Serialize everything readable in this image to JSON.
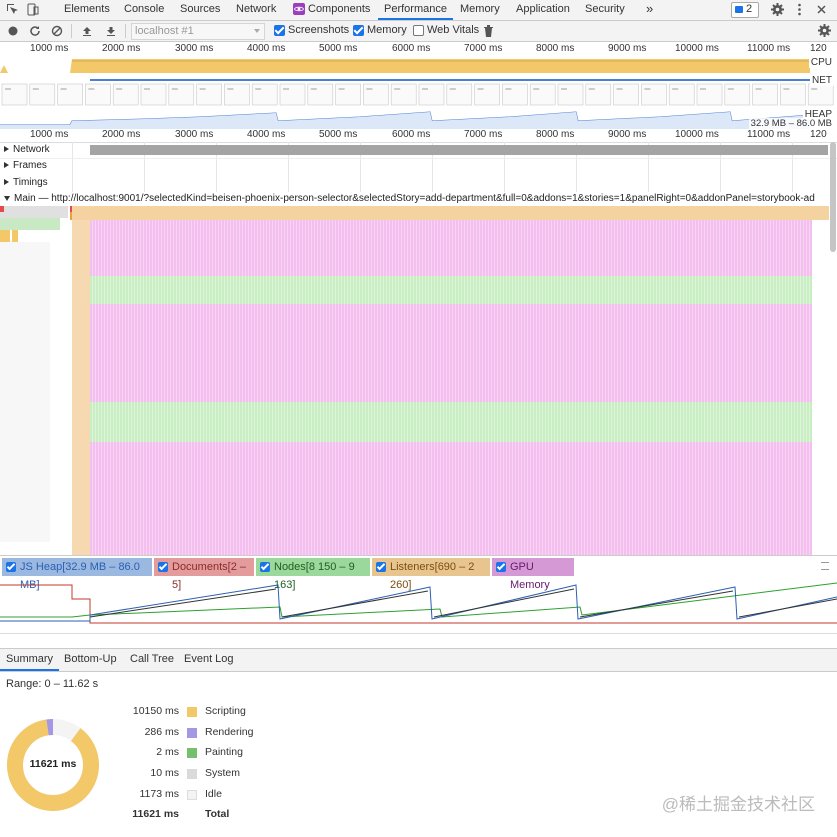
{
  "tabs": [
    {
      "label": "Elements"
    },
    {
      "label": "Console"
    },
    {
      "label": "Sources"
    },
    {
      "label": "Network"
    },
    {
      "label": "Components"
    },
    {
      "label": "Performance"
    },
    {
      "label": "Memory"
    },
    {
      "label": "Application"
    },
    {
      "label": "Security"
    }
  ],
  "more_tabs": "»",
  "issues_badge": "2",
  "toolbar": {
    "target": "localhost #1",
    "screenshots_label": "Screenshots",
    "memory_label": "Memory",
    "webvitals_label": "Web Vitals",
    "screenshots_checked": true,
    "memory_checked": true,
    "webvitals_checked": false
  },
  "overview_ticks": [
    "1000 ms",
    "2000 ms",
    "3000 ms",
    "4000 ms",
    "5000 ms",
    "6000 ms",
    "7000 ms",
    "8000 ms",
    "9000 ms",
    "10000 ms",
    "11000 ms",
    "120"
  ],
  "overview_labels": {
    "cpu": "CPU",
    "net": "NET",
    "heap": "HEAP",
    "heap_range": "32.9 MB – 86.0 MB"
  },
  "main_ticks": [
    "1000 ms",
    "2000 ms",
    "3000 ms",
    "4000 ms",
    "5000 ms",
    "6000 ms",
    "7000 ms",
    "8000 ms",
    "9000 ms",
    "10000 ms",
    "11000 ms",
    "120"
  ],
  "tracks": {
    "network": "Network",
    "frames": "Frames",
    "timings": "Timings",
    "main": "Main — http://localhost:9001/?selectedKind=beisen-phoenix-person-selector&selectedStory=add-department&full=0&addons=1&stories=1&panelRight=0&addonPanel=storybook-ad"
  },
  "counters": [
    {
      "label": "JS Heap[32.9 MB – 86.0 MB]",
      "color": "#2b5fb3",
      "bg": "#9bb8e0"
    },
    {
      "label": "Documents[2 – 5]",
      "color": "#8a2b2b",
      "bg": "#e39b9b"
    },
    {
      "label": "Nodes[8 150 – 9 163]",
      "color": "#1f5f1f",
      "bg": "#9bd89b"
    },
    {
      "label": "Listeners[690 – 2 260]",
      "color": "#7a4f10",
      "bg": "#e8c48f"
    },
    {
      "label": "GPU Memory",
      "color": "#6a1a6a",
      "bg": "#d59ad5"
    }
  ],
  "bottom_tabs": [
    {
      "label": "Summary"
    },
    {
      "label": "Bottom-Up"
    },
    {
      "label": "Call Tree"
    },
    {
      "label": "Event Log"
    }
  ],
  "summary": {
    "range": "Range: 0 – 11.62 s",
    "donut_center": "11621 ms",
    "rows": [
      {
        "value": "10150 ms",
        "name": "Scripting",
        "color": "#f2c869"
      },
      {
        "value": "286 ms",
        "name": "Rendering",
        "color": "#a597e4"
      },
      {
        "value": "2 ms",
        "name": "Painting",
        "color": "#76c06d"
      },
      {
        "value": "10 ms",
        "name": "System",
        "color": "#dadada"
      },
      {
        "value": "1173 ms",
        "name": "Idle",
        "color": "#f4f4f4"
      }
    ],
    "total_value": "11621 ms",
    "total_label": "Total"
  },
  "watermark": "@稀土掘金技术社区"
}
